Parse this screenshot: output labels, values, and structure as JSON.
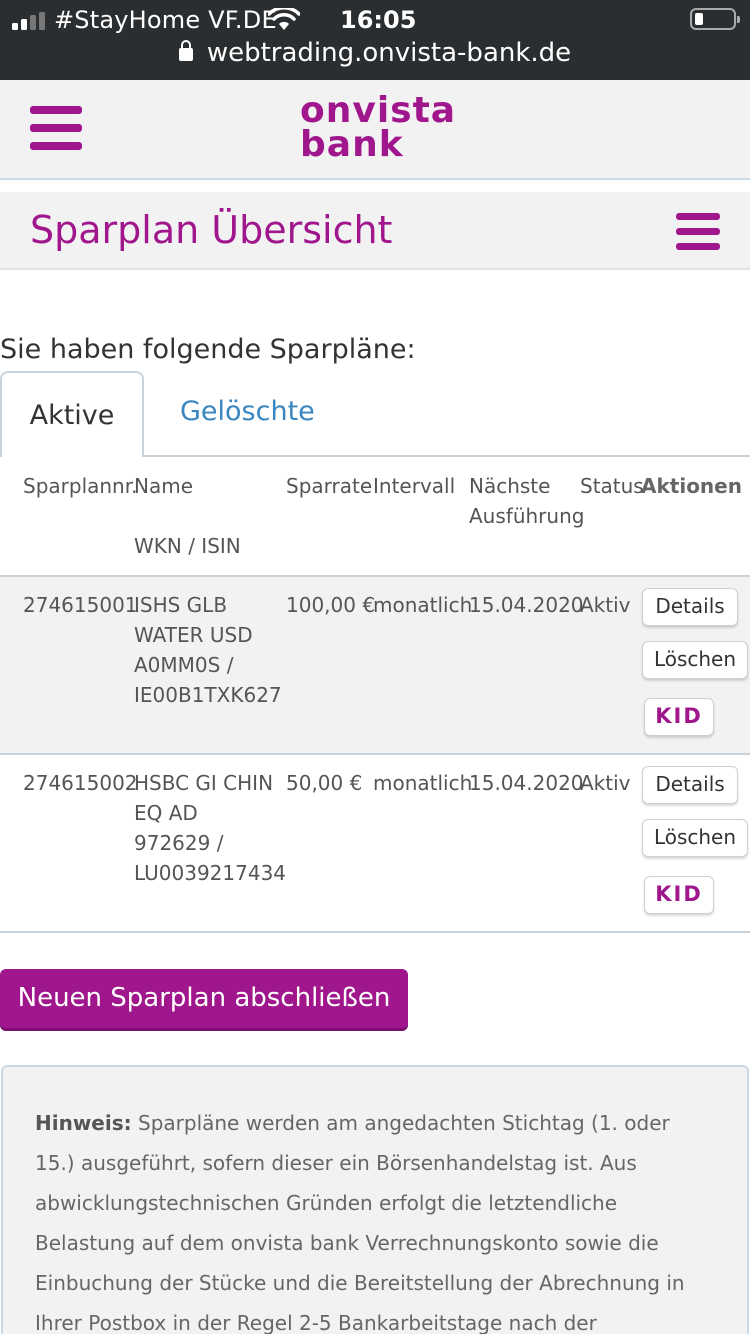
{
  "status_bar": {
    "carrier": "#StayHome VF.DE",
    "time": "16:05",
    "url": "webtrading.onvista-bank.de",
    "icons": [
      "signal-icon",
      "wifi-icon",
      "lock-icon",
      "battery-icon"
    ]
  },
  "header": {
    "logo_line1": "onvista",
    "logo_line2": "bank"
  },
  "page": {
    "title": "Sparplan Übersicht",
    "intro": "Sie haben folgende Sparpläne:"
  },
  "tabs": [
    {
      "label": "Aktive",
      "active": true
    },
    {
      "label": "Gelöschte",
      "active": false
    }
  ],
  "table": {
    "headers": {
      "number": "Sparplannr.",
      "name": "Name",
      "wkn": "WKN / ISIN",
      "rate": "Sparrate",
      "interval": "Intervall",
      "next_line1": "Nächste",
      "next_line2": "Ausführung",
      "status": "Status",
      "actions": "Aktionen"
    },
    "rows": [
      {
        "number": "274615001",
        "name_line1": "ISHS GLB",
        "name_line2": "WATER USD",
        "wkn": "A0MM0S /",
        "isin": "IE00B1TXK627",
        "rate": "100,00 €",
        "interval": "monatlich",
        "next": "15.04.2020",
        "status": "Aktiv"
      },
      {
        "number": "274615002",
        "name_line1": "HSBC GI CHIN",
        "name_line2": "EQ AD",
        "wkn": "972629 /",
        "isin": "LU0039217434",
        "rate": "50,00 €",
        "interval": "monatlich",
        "next": "15.04.2020",
        "status": "Aktiv"
      }
    ],
    "actions": {
      "details": "Details",
      "delete": "Löschen",
      "kid": "KID"
    }
  },
  "cta_label": "Neuen Sparplan abschließen",
  "note": {
    "label": "Hinweis:",
    "text": " Sparpläne werden am angedachten Stichtag (1. oder 15.) ausgeführt, sofern dieser ein Börsenhandelstag ist. Aus abwicklungstechnischen Gründen erfolgt die letztendliche Belastung auf dem onvista bank Verrechnungskonto sowie die Einbuchung der Stücke und die Bereitstellung der Abrechnung in Ihrer Postbox in der Regel 2-5 Bankarbeitstage nach der Sparplanausführung."
  },
  "colors": {
    "brand": "#a0178d",
    "link": "#3a86c0",
    "statusbar": "#2b2e30",
    "header_bg": "#f2f2f2"
  }
}
